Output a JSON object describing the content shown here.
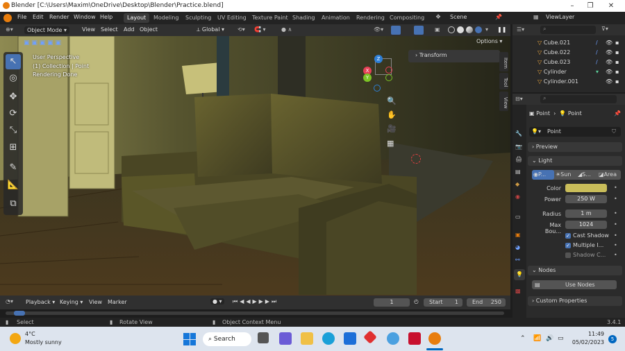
{
  "window": {
    "title": "Blender [C:\\Users\\Maxim\\OneDrive\\Desktop\\Blender\\Practice.blend]",
    "minimize": "–",
    "maximize": "❐",
    "close": "✕"
  },
  "menubar": {
    "menus": [
      "File",
      "Edit",
      "Render",
      "Window",
      "Help"
    ],
    "workspaces": [
      "Layout",
      "Modeling",
      "Sculpting",
      "UV Editing",
      "Texture Paint",
      "Shading",
      "Animation",
      "Rendering",
      "Compositing"
    ],
    "scene": "Scene",
    "view_layer": "ViewLayer"
  },
  "viewport_header": {
    "mode": "Object Mode",
    "menus": [
      "View",
      "Select",
      "Add",
      "Object"
    ],
    "orientation": "Global",
    "options": "Options"
  },
  "viewport": {
    "info": [
      "User Perspective",
      "(1) Collection | Point",
      "Rendering Done"
    ],
    "transform_label": "Transform",
    "side_tabs": [
      "Item",
      "Tool",
      "View"
    ],
    "axes": {
      "x": "X",
      "y": "Y",
      "z": "Z"
    }
  },
  "outliner": {
    "items": [
      "Cube.021",
      "Cube.022",
      "Cube.023",
      "Cylinder",
      "Cylinder.001"
    ]
  },
  "properties": {
    "breadcrumb": [
      "Point",
      "Point"
    ],
    "data_name": "Point",
    "sections": {
      "preview": "Preview",
      "light": "Light",
      "nodes": "Nodes",
      "custom": "Custom Properties"
    },
    "light_types": [
      "P...",
      "Sun",
      "S...",
      "Area"
    ],
    "color_label": "Color",
    "color_value": "#c9bd5a",
    "power_label": "Power",
    "power_value": "250 W",
    "radius_label": "Radius",
    "radius_value": "1 m",
    "maxbou_label": "Max Bou...",
    "maxbou_value": "1024",
    "cast_shadow": "Cast Shadow",
    "multiple": "Multiple I...",
    "shadow_c": "Shadow C...",
    "use_nodes": "Use Nodes"
  },
  "timeline": {
    "menus": [
      "Playback",
      "Keying",
      "View",
      "Marker"
    ],
    "current_frame": "1",
    "start_label": "Start",
    "start": "1",
    "end_label": "End",
    "end": "250"
  },
  "statusbar": {
    "select": "Select",
    "rotate": "Rotate View",
    "context": "Object Context Menu",
    "version": "3.4.1"
  },
  "taskbar": {
    "temp": "4°C",
    "weather": "Mostly sunny",
    "search": "Search",
    "time": "11:49",
    "date": "05/02/2023",
    "badge": "5"
  }
}
